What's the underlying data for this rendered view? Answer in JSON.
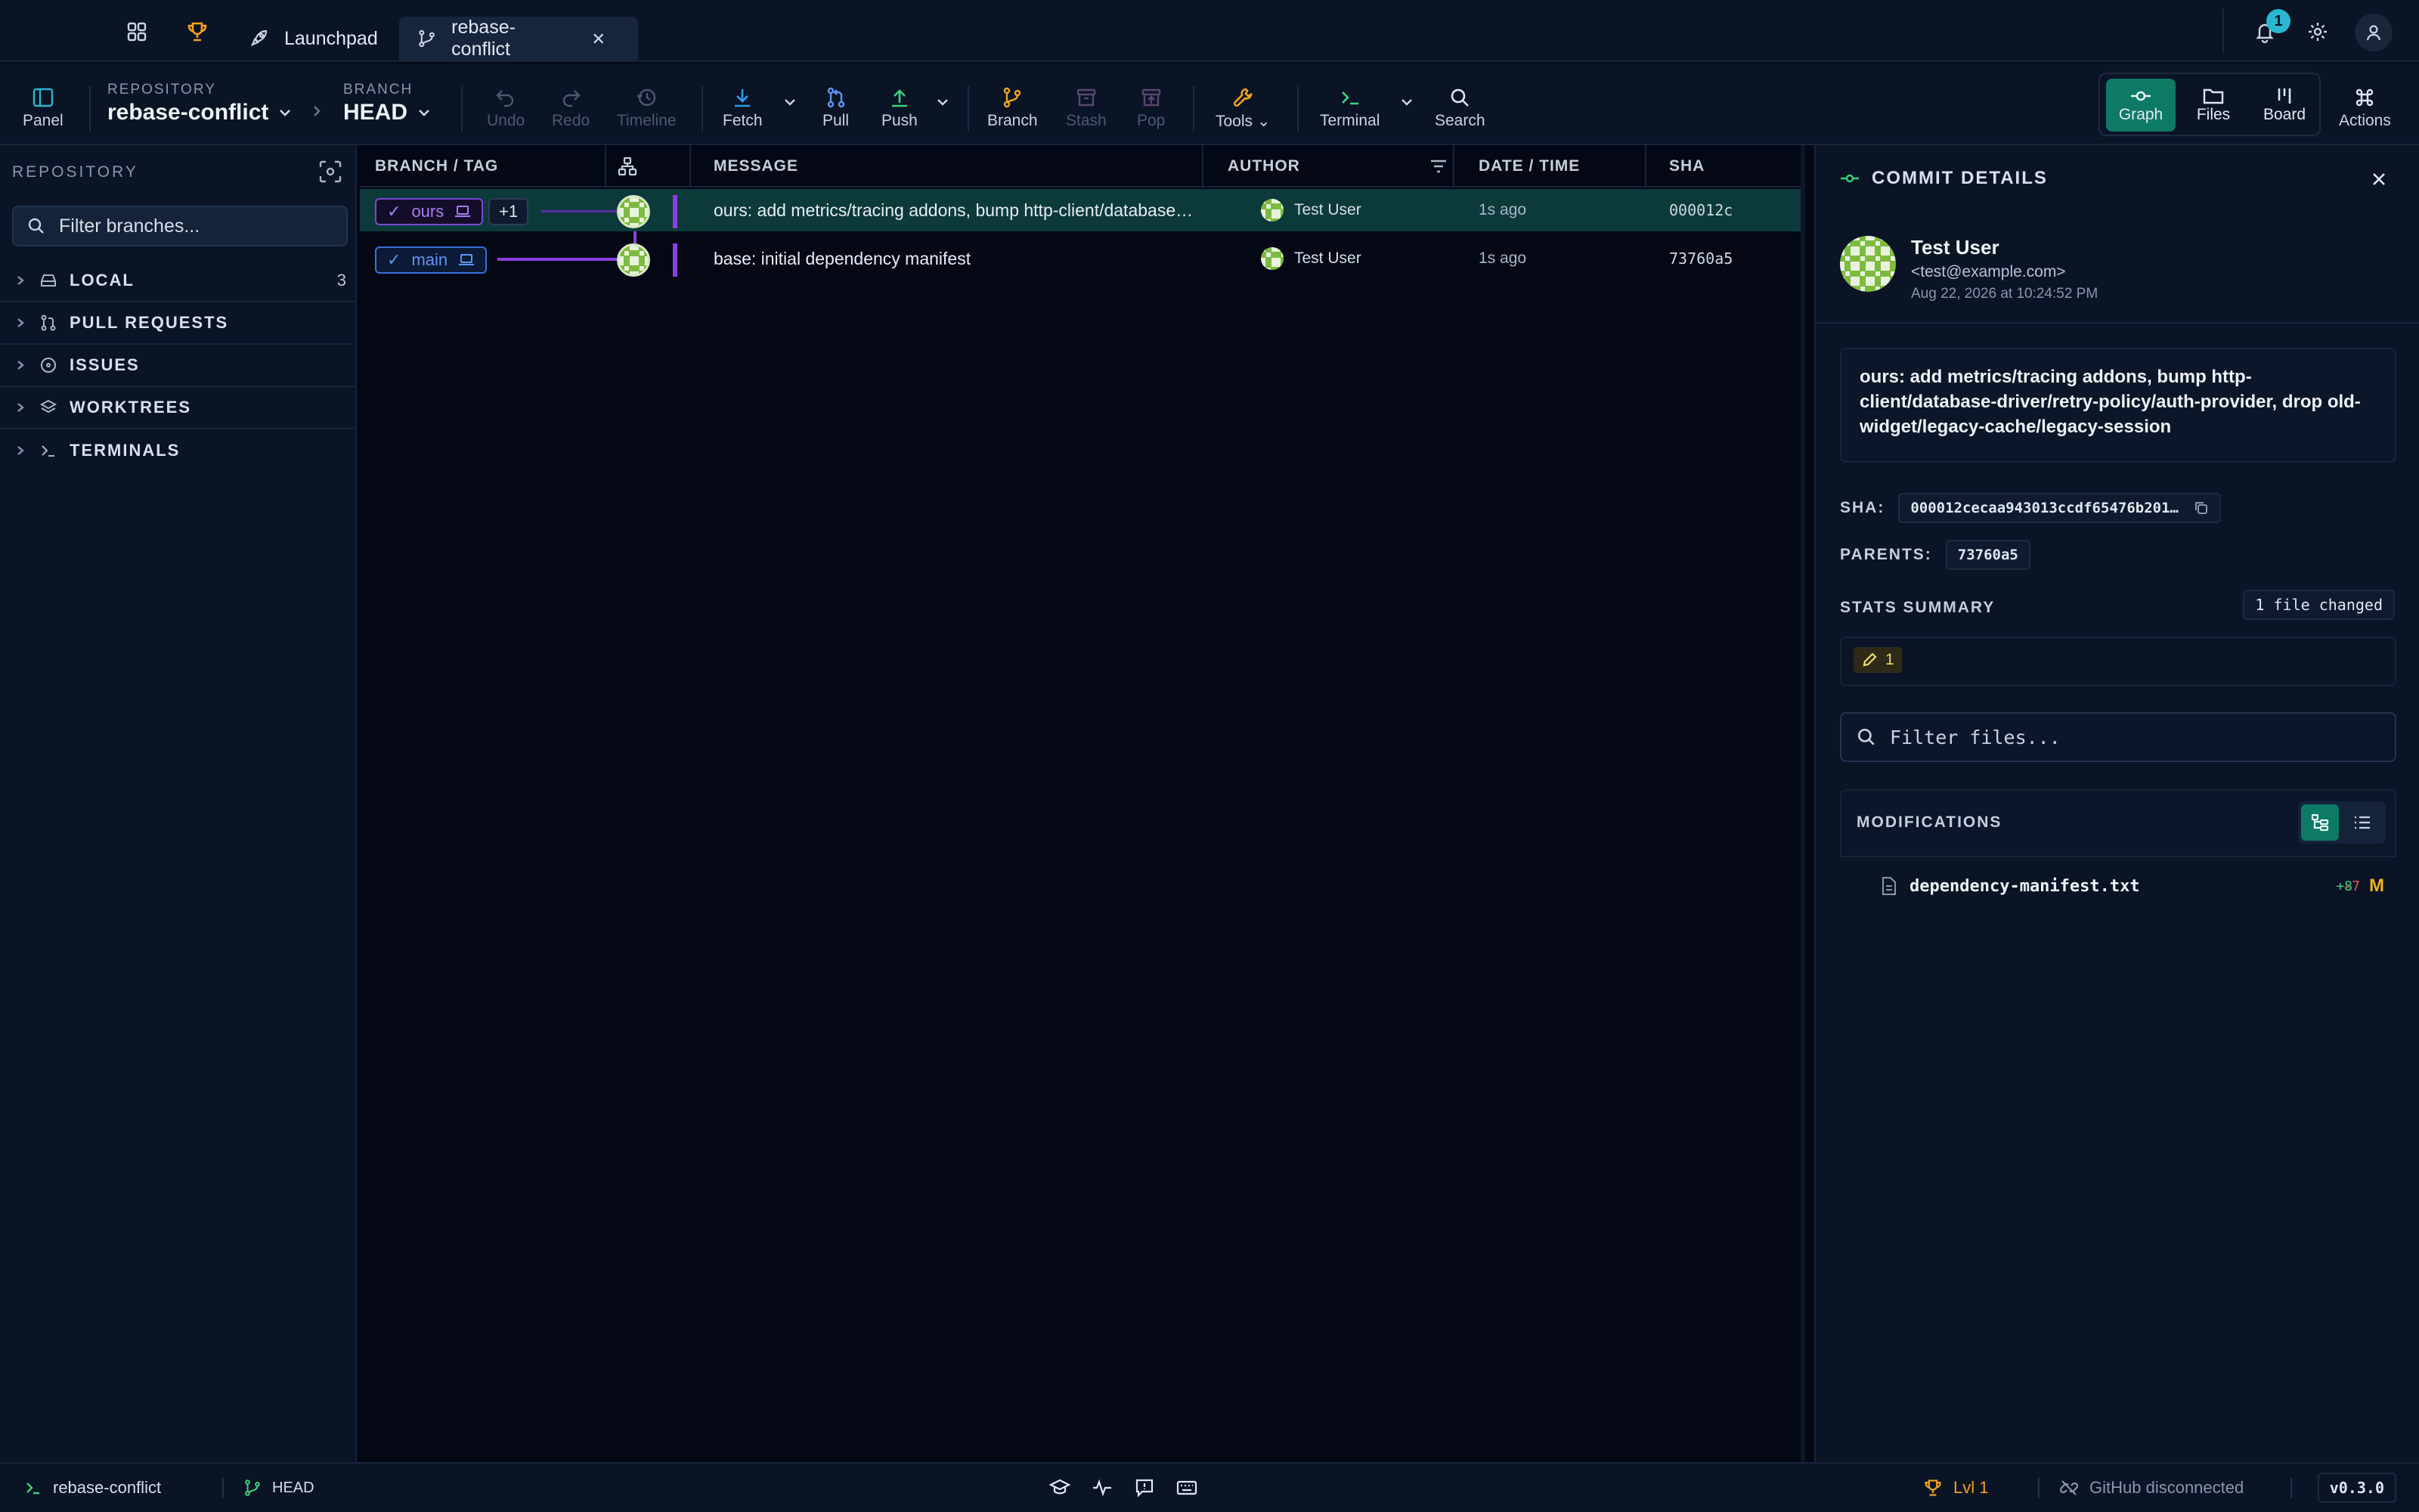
{
  "tabs": [
    {
      "label": "Launchpad",
      "icon": "rocket-icon"
    },
    {
      "label": "rebase-conflict",
      "icon": "branch-icon",
      "active": true
    }
  ],
  "notifications": {
    "count": "1"
  },
  "toolbar": {
    "panel_label": "Panel",
    "repository_label": "REPOSITORY",
    "repository_value": "rebase-conflict",
    "branch_label": "BRANCH",
    "branch_value": "HEAD",
    "undo": "Undo",
    "redo": "Redo",
    "timeline": "Timeline",
    "fetch": "Fetch",
    "pull": "Pull",
    "push": "Push",
    "branch": "Branch",
    "stash": "Stash",
    "pop": "Pop",
    "tools": "Tools",
    "terminal": "Terminal",
    "search": "Search",
    "views": {
      "graph": "Graph",
      "files": "Files",
      "board": "Board"
    },
    "actions": "Actions"
  },
  "sidebar": {
    "title": "REPOSITORY",
    "search_placeholder": "Filter branches...",
    "sections": [
      {
        "label": "LOCAL",
        "count": "3",
        "icon": "local-drive-icon"
      },
      {
        "label": "PULL REQUESTS",
        "count": "",
        "icon": "pull-request-icon"
      },
      {
        "label": "ISSUES",
        "count": "",
        "icon": "issue-icon"
      },
      {
        "label": "WORKTREES",
        "count": "",
        "icon": "layers-icon"
      },
      {
        "label": "TERMINALS",
        "count": "",
        "icon": "terminal-icon"
      }
    ]
  },
  "graph": {
    "columns": {
      "branch": "BRANCH / TAG",
      "message": "MESSAGE",
      "author": "AUTHOR",
      "date": "DATE / TIME",
      "sha": "SHA"
    },
    "commits": [
      {
        "branch": "ours",
        "extra": "+1",
        "message": "ours: add metrics/tracing addons, bump http-client/database-driver/retry-policy/auth-provider, drop old-widget/legacy-cache/legacy-session",
        "author": "Test User",
        "date": "1s ago",
        "sha": "000012c",
        "selected": true
      },
      {
        "branch": "main",
        "extra": "",
        "message": "base: initial dependency manifest",
        "author": "Test User",
        "date": "1s ago",
        "sha": "73760a5",
        "selected": false
      }
    ]
  },
  "details": {
    "title": "COMMIT DETAILS",
    "author_name": "Test User",
    "author_email": "<test@example.com>",
    "author_date": "Aug 22, 2026 at 10:24:52 PM",
    "message": "ours: add metrics/tracing addons, bump http-client/database-driver/retry-policy/auth-provider, drop old-widget/legacy-cache/legacy-session",
    "sha_label": "SHA:",
    "sha_value": "000012cecaa943013ccdf65476b201…",
    "parents_label": "PARENTS:",
    "parents_value": "73760a5",
    "stats_label": "STATS SUMMARY",
    "files_changed": "1 file changed",
    "modified_count": "1",
    "filter_placeholder": "Filter files...",
    "modifications_label": "MODIFICATIONS",
    "files": [
      {
        "name": "dependency-manifest.txt",
        "added": "+8",
        "removed": "-7",
        "status": "M"
      }
    ]
  },
  "statusbar": {
    "repo": "rebase-conflict",
    "branch": "HEAD",
    "level": "Lvl 1",
    "github": "GitHub disconnected",
    "version": "v0.3.0"
  },
  "colors": {
    "accent": "#0d7a66",
    "branch_ours": "#8b3fe0",
    "branch_main": "#3a6fd8",
    "modified": "#f2b21c"
  }
}
